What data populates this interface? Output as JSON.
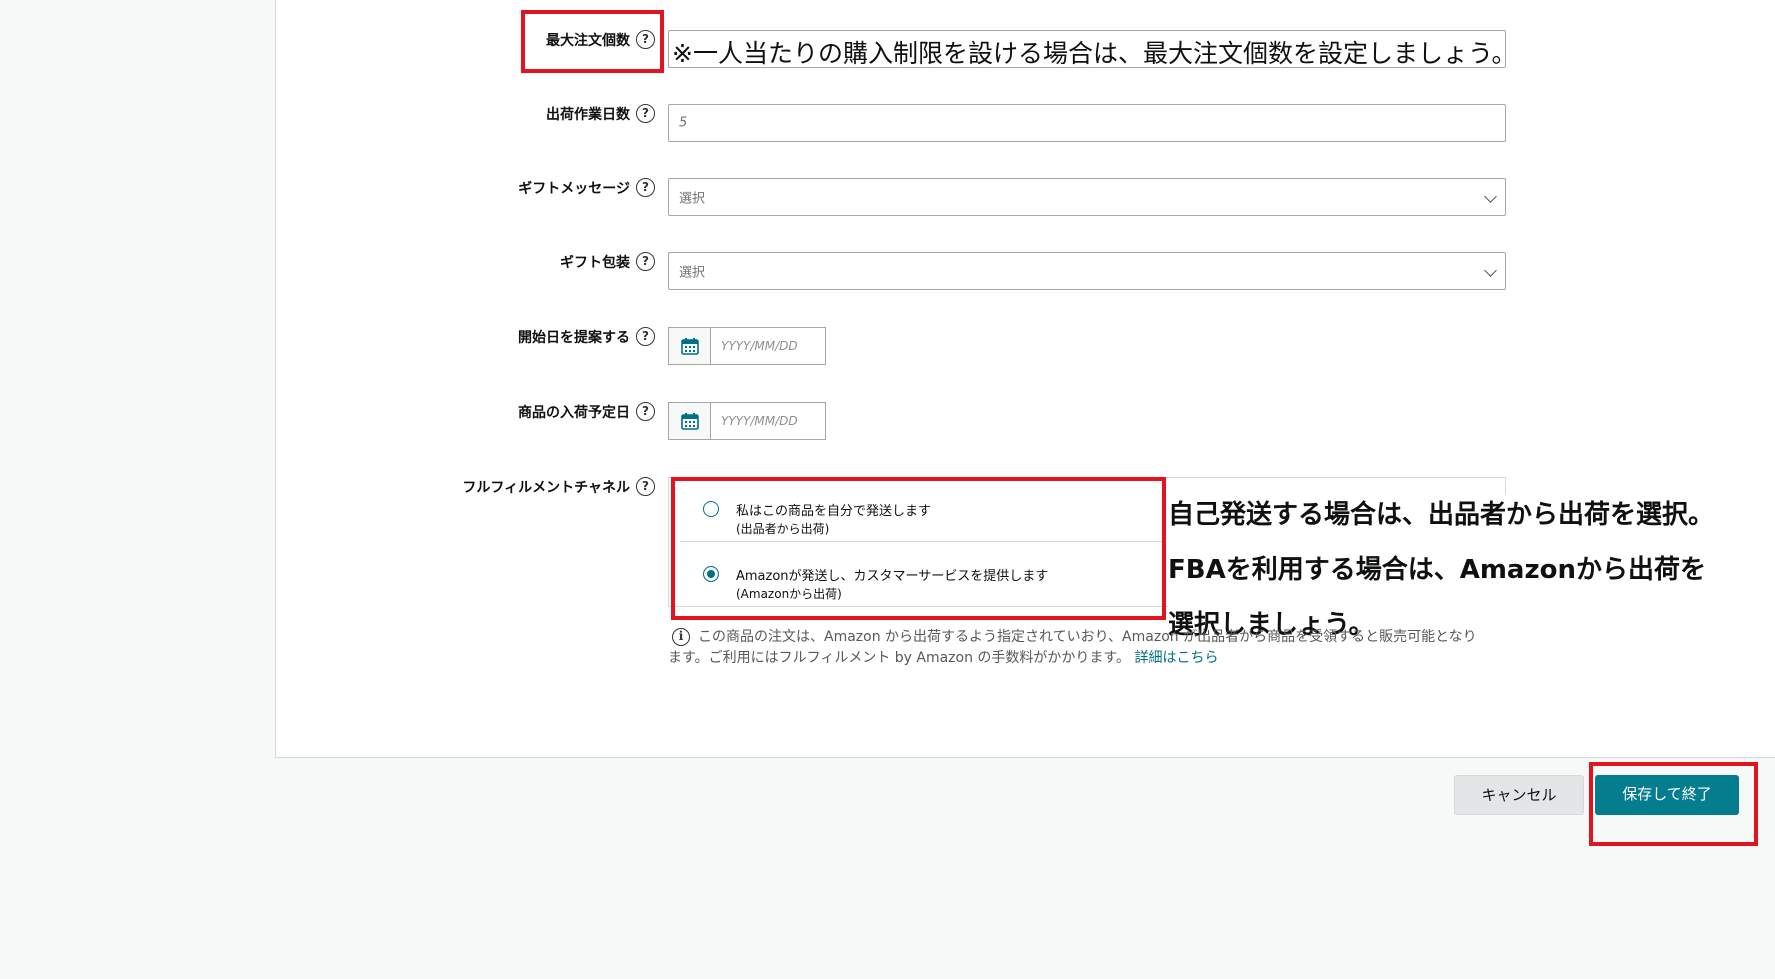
{
  "form": {
    "max_order": {
      "label": "最大注文個数",
      "help": "?"
    },
    "handling_time": {
      "label": "出荷作業日数",
      "help": "?",
      "value": "5"
    },
    "gift_message": {
      "label": "ギフトメッセージ",
      "help": "?",
      "value": "選択"
    },
    "gift_wrap": {
      "label": "ギフト包装",
      "help": "?",
      "value": "選択"
    },
    "start_date": {
      "label": "開始日を提案する",
      "help": "?",
      "placeholder": "YYYY/MM/DD"
    },
    "restock_date": {
      "label": "商品の入荷予定日",
      "help": "?",
      "placeholder": "YYYY/MM/DD"
    },
    "fulfillment": {
      "label": "フルフィルメントチャネル",
      "help": "?",
      "options": [
        {
          "line1": "私はこの商品を自分で発送します",
          "line2": "(出品者から出荷)",
          "selected": false
        },
        {
          "line1": "Amazonが発送し、カスタマーサービスを提供します",
          "line2": "(Amazonから出荷)",
          "selected": true
        }
      ],
      "note_line1": "この商品の注文は、Amazon から出荷するよう指定されていおり、Amazon が出品者から商品を受領すると販売可能となり",
      "note_line2": "ます。ご利用にはフルフィルメント by Amazon の手数料がかかります。",
      "note_link": "詳細はこちら"
    }
  },
  "annotations": {
    "max_order_tip": "※一人当たりの購入制限を設ける場合は、最大注文個数を設定しましょう。",
    "fulfillment_tip_1": "自己発送する場合は、出品者から出荷を選択。",
    "fulfillment_tip_2": "FBAを利用する場合は、Amazonから出荷を",
    "fulfillment_tip_3": "選択しましょう。"
  },
  "buttons": {
    "cancel": "キャンセル",
    "save": "保存して終了"
  },
  "colors": {
    "accent": "#047d8f",
    "highlight": "#e1141f"
  }
}
